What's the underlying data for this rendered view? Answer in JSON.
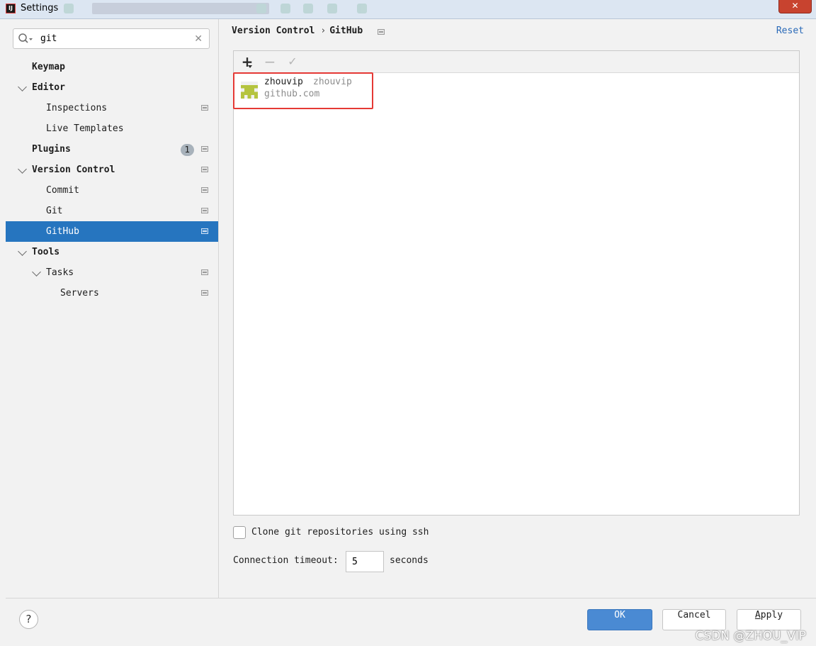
{
  "window": {
    "title": "Settings"
  },
  "search": {
    "value": "git"
  },
  "tree": [
    {
      "label": "Keymap",
      "bold": true,
      "level": 0,
      "chevron": "none"
    },
    {
      "label": "Editor",
      "bold": true,
      "level": 0,
      "chevron": "expanded"
    },
    {
      "label": "Inspections",
      "bold": false,
      "level": 1,
      "chevron": "none",
      "project_icon": true
    },
    {
      "label": "Live Templates",
      "bold": false,
      "level": 1,
      "chevron": "none"
    },
    {
      "label": "Plugins",
      "bold": true,
      "level": 0,
      "chevron": "none",
      "badge": "1",
      "project_icon": true
    },
    {
      "label": "Version Control",
      "bold": true,
      "level": 0,
      "chevron": "expanded",
      "project_icon": true
    },
    {
      "label": "Commit",
      "bold": false,
      "level": 1,
      "chevron": "none",
      "project_icon": true
    },
    {
      "label": "Git",
      "bold": false,
      "level": 1,
      "chevron": "none",
      "project_icon": true
    },
    {
      "label": "GitHub",
      "bold": false,
      "level": 1,
      "chevron": "none",
      "project_icon": true,
      "selected": true
    },
    {
      "label": "Tools",
      "bold": true,
      "level": 0,
      "chevron": "expanded"
    },
    {
      "label": "Tasks",
      "bold": false,
      "level": 1,
      "chevron": "expanded",
      "project_icon": true
    },
    {
      "label": "Servers",
      "bold": false,
      "level": 2,
      "chevron": "none",
      "project_icon": true
    }
  ],
  "breadcrumb": {
    "parent": "Version Control",
    "separator": "›",
    "current": "GitHub"
  },
  "reset_label": "Reset",
  "toolbar": {
    "add": "+",
    "remove": "−",
    "check": "✓"
  },
  "account": {
    "name": "zhouvip",
    "login": "zhouvip",
    "server": "github.com",
    "avatar_color": "#b5c43f"
  },
  "clone_ssh": {
    "label": "Clone git repositories using ssh",
    "checked": false
  },
  "timeout": {
    "label": "Connection timeout:",
    "value": "5",
    "unit": "seconds"
  },
  "buttons": {
    "help": "?",
    "ok": "OK",
    "cancel": "Cancel",
    "apply_underlined": "A",
    "apply_rest": "pply"
  },
  "watermark": "CSDN @ZHOU_VIP",
  "colors": {
    "selection": "#2675bf",
    "ok_button": "#4a8ad3",
    "link": "#2a6ab8",
    "highlight_box": "#e53935"
  }
}
